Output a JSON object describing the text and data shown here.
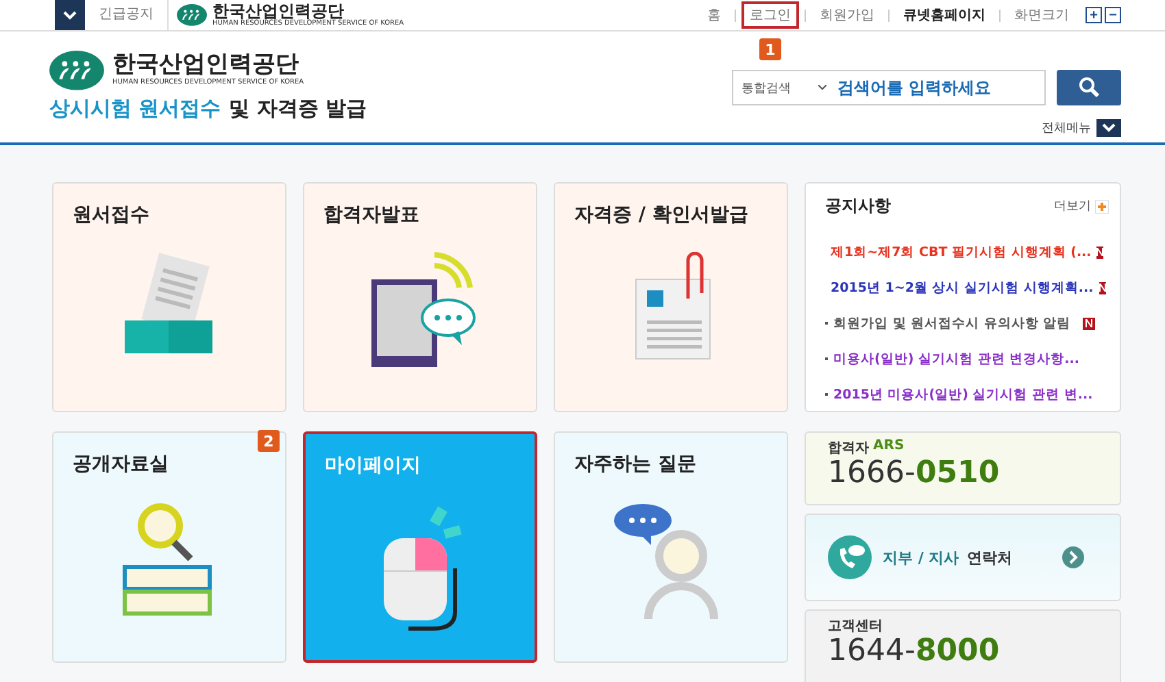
{
  "top_bar": {
    "emergency_label": "긴급공지",
    "logo_name": "한국산업인력공단",
    "logo_sub": "HUMAN RESOURCES DEVELOPMENT SERVICE OF KOREA",
    "links": [
      {
        "label": "홈",
        "bold": false,
        "highlighted": false
      },
      {
        "label": "로그인",
        "bold": false,
        "highlighted": true,
        "badge": "1"
      },
      {
        "label": "회원가입",
        "bold": false,
        "highlighted": false
      },
      {
        "label": "큐넷홈페이지",
        "bold": true,
        "highlighted": false
      },
      {
        "label": "화면크기",
        "bold": false,
        "highlighted": false
      }
    ],
    "zoom_buttons": [
      "+",
      "−"
    ]
  },
  "header": {
    "logo_name": "한국산업인력공단",
    "logo_sub": "HUMAN RESOURCES DEVELOPMENT SERVICE OF KOREA",
    "title_accent": "상시시험 원서접수",
    "title_rest": "및 자격증 발급",
    "search": {
      "scope": "통합검색",
      "placeholder": "검색어를 입력하세요"
    },
    "all_menu": "전체메뉴"
  },
  "tiles": [
    {
      "label": "원서접수",
      "kind": "tray",
      "color": "#fff4ee",
      "selected": false
    },
    {
      "label": "합격자발표",
      "kind": "tablet",
      "color": "#fff4ee",
      "selected": false
    },
    {
      "label": "자격증 / 확인서발급",
      "kind": "certificate",
      "color": "#fff4ee",
      "selected": false
    },
    {
      "label": "공개자료실",
      "kind": "books",
      "color": "#eef9fd",
      "selected": false,
      "badge": "2"
    },
    {
      "label": "마이페이지",
      "kind": "mouse",
      "color": "#12b0ec",
      "selected": true
    },
    {
      "label": "자주하는 질문",
      "kind": "person",
      "color": "#eef9fd",
      "selected": false
    }
  ],
  "notice": {
    "title": "공지사항",
    "more": "더보기",
    "items": [
      {
        "text": "제1회~제7회 CBT 필기시험 시행계획 (...",
        "color": "#e8321e",
        "new": true
      },
      {
        "text": "2015년 1~2월 상시 실기시험 시행계획...",
        "color": "#2b35b8",
        "new": true
      },
      {
        "text": "회원가입 및 원서접수시 유의사항 알림",
        "color": "#555555",
        "new": true
      },
      {
        "text": "미용사(일반) 실기시험 관련 변경사항...",
        "color": "#8a2fc8",
        "new": false
      },
      {
        "text": "2015년 미용사(일반) 실기시험 관련 변...",
        "color": "#8a2fc8",
        "new": false
      }
    ]
  },
  "contacts": [
    {
      "kind": "phone",
      "label": "합격자",
      "label_accent": "ARS",
      "number_prefix": "1666-",
      "number_accent": "0510"
    },
    {
      "kind": "link",
      "label_accent": "지부 / 지사",
      "label": "연락처"
    },
    {
      "kind": "phone",
      "label": "고객센터",
      "number_prefix": "1644-",
      "number_accent": "8000"
    }
  ]
}
